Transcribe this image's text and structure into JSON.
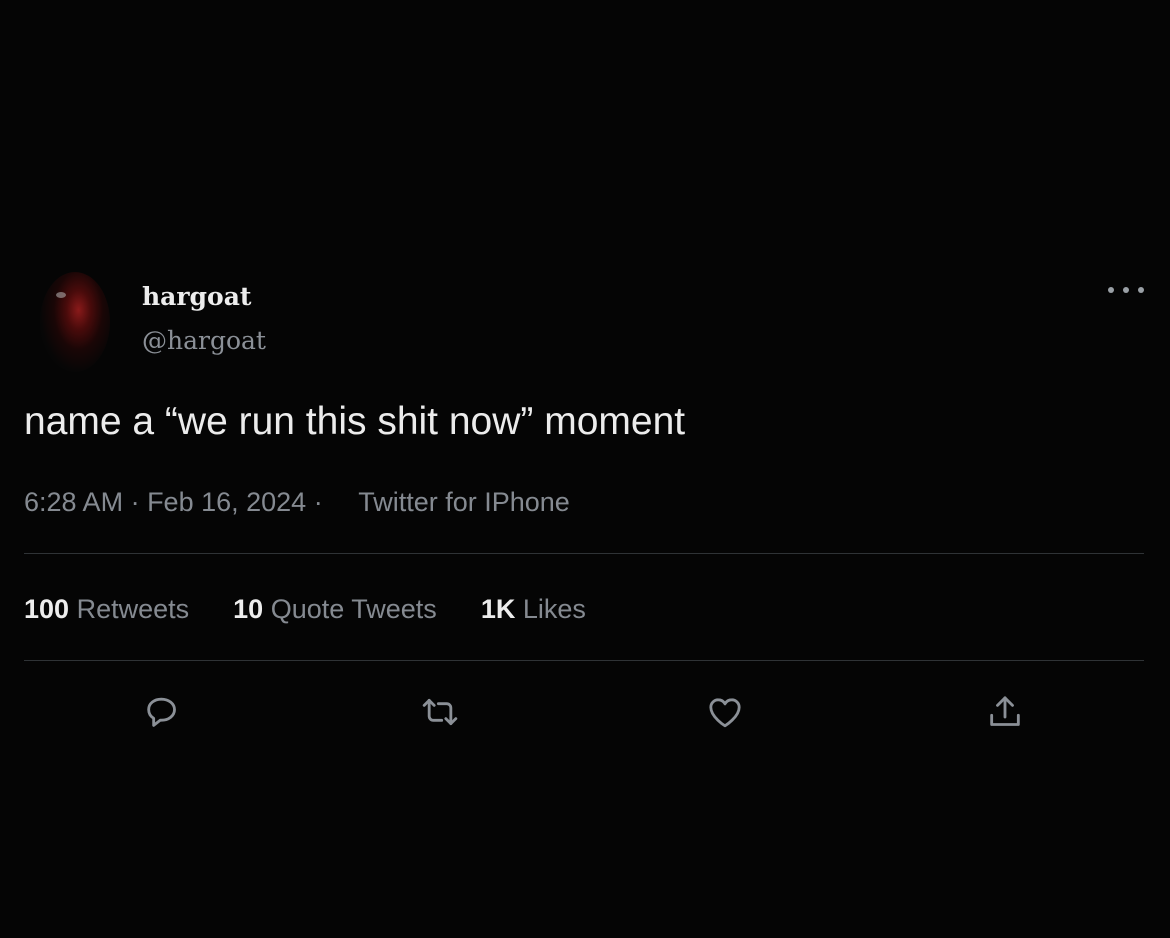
{
  "user": {
    "display_name": "hargoat",
    "handle": "@hargoat",
    "avatar_icon": "avatar-photo"
  },
  "tweet": {
    "text": "name a “we run this shit now” moment",
    "time": "6:28 AM",
    "sep1": " · ",
    "date": "Feb 16, 2024",
    "sep2": " · ",
    "source": "Twitter for IPhone"
  },
  "stats": {
    "retweets_count": "100",
    "retweets_label": "Retweets",
    "quotes_count": "10",
    "quotes_label": "Quote Tweets",
    "likes_count": "1K",
    "likes_label": "Likes"
  },
  "actions": {
    "icons": [
      "reply-icon",
      "retweet-icon",
      "like-icon",
      "share-icon"
    ]
  },
  "colors": {
    "background": "#050505",
    "text_primary": "#ececec",
    "text_secondary": "#858a91",
    "divider": "#2f3336"
  }
}
